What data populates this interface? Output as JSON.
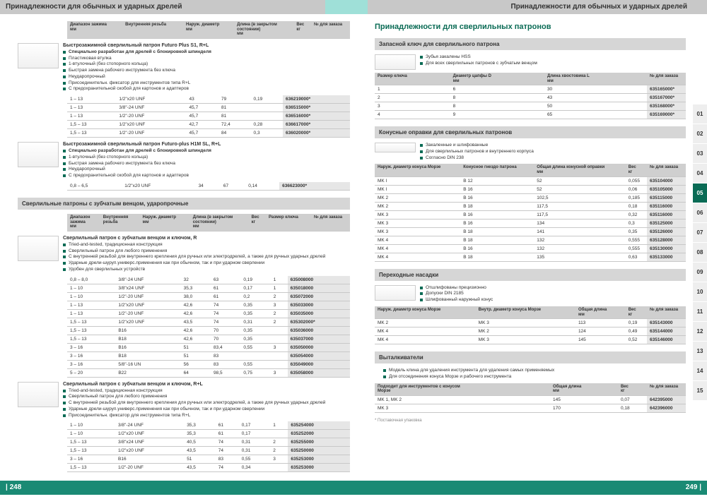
{
  "header_left": "Принадлежности для обычных и ударных дрелей",
  "header_right": "Принадлежности для обычных и ударных дрелей",
  "page_left": "| 248",
  "page_right": "249 |",
  "tabs": [
    "01",
    "02",
    "03",
    "04",
    "05",
    "06",
    "07",
    "08",
    "09",
    "10",
    "11",
    "12",
    "13",
    "14",
    "15"
  ],
  "tab_active": "05",
  "footnote": "* Поставочная упаковка",
  "left": {
    "hdr1": [
      "Диапазон зажима\nмм",
      "Внутренняя резьба",
      "Наруж. диаметр\nмм",
      "Длина (в закрытом\nсостоянии)\nмм",
      "Вес\nкг",
      "№ для заказа"
    ],
    "p1": {
      "title": "Быстрозажимной сверлильный патрон Futuro Plus S1, R+L",
      "features": [
        "Специально разработан для дрелей с блокировкой шпинделя",
        "Пластиковая втулка",
        "1-втулочный (без стопорного кольца)",
        "Быстрая замена рабочего инструмента без ключа",
        "Неударопрочный",
        "Присоединительн. фиксатор для инструментов типа R+L",
        "С предохранительной скобой для картонов и адаптеров"
      ],
      "rows": [
        [
          "1 – 13",
          "1/2\"x20 UNF",
          "43",
          "79",
          "0,19",
          "636219000*"
        ],
        [
          "1 – 13",
          "3/8\"-24 UNF",
          "45,7",
          "81",
          "",
          "636515000*"
        ],
        [
          "1 – 13",
          "1/2\"-20 UNF",
          "45,7",
          "81",
          "",
          "636516000*"
        ],
        [
          "1,5 – 13",
          "1/2\"x20 UNF",
          "42,7",
          "72,4",
          "0,28",
          "636617000*"
        ],
        [
          "1,5 – 13",
          "1/2\"-20 UNF",
          "45,7",
          "84",
          "0,3",
          "636020000*"
        ]
      ]
    },
    "p2": {
      "title": "Быстрозажимной сверлильный патрон Futuro-plus H1M SL, R+L",
      "features": [
        "Специально разработан для дрелей с блокировкой шпинделя",
        "1-втулочный (без стопорного кольца)",
        "Быстрая замена рабочего инструмента без ключа",
        "Неударопрочный",
        "С предохранительной скобой для картонов и адаптеров"
      ],
      "rows": [
        [
          "0,8 – 6,5",
          "1/2\"x20 UNF",
          "34",
          "67",
          "0,14",
          "636623000*"
        ]
      ]
    },
    "section2": "Сверлильные патроны с зубчатым венцом, ударопрочные",
    "hdr2": [
      "Диапазон\nзажима\nмм",
      "Внутренняя\nрезьба",
      "Наруж. диаметр\nмм",
      "Длина (в закрытом\nсостоянии)\nмм",
      "Вес\nкг",
      "Размер ключа",
      "№ для заказа"
    ],
    "p3": {
      "title": "Сверлильный патрон с зубчатым венцом и ключом, R",
      "features": [
        "Tried-and-tested, традиционная конструкция",
        "Сверлильный патрон для любого применения",
        "С внутренней резьбой для внутреннего крепления для ручных или электродрелей, а также для ручных ударных дрелей",
        "Ударные дрели-шуруп.универс.применения как при обычном, так и при ударном сверлении",
        "Удобен для сверлильных устройств"
      ],
      "rows": [
        [
          "0,8 – 8,0",
          "3/8\"-24 UNF",
          "32",
          "63",
          "0,19",
          "1",
          "635008000"
        ],
        [
          "1 – 10",
          "3/8\"x24 UNF",
          "35,3",
          "61",
          "0,17",
          "1",
          "635018000"
        ],
        [
          "1 – 10",
          "1/2\"-20 UNF",
          "38,0",
          "61",
          "0,2",
          "2",
          "635072000"
        ],
        [
          "1 – 13",
          "1/2\"x20 UNF",
          "42,6",
          "74",
          "0,35",
          "3",
          "635033000"
        ],
        [
          "1 – 13",
          "1/2\"-20 UNF",
          "42,6",
          "74",
          "0,35",
          "2",
          "635035000"
        ],
        [
          "1,5 – 13",
          "1/2\"x20 UNF",
          "43,5",
          "74",
          "0,31",
          "2",
          "635302000*"
        ],
        [
          "1,5 – 13",
          "B16",
          "42,6",
          "70",
          "0,35",
          "",
          "635036000"
        ],
        [
          "1,5 – 13",
          "B18",
          "42,6",
          "70",
          "0,35",
          "",
          "635037000"
        ],
        [
          "3 – 16",
          "B16",
          "51",
          "83,4",
          "0,55",
          "3",
          "635050000"
        ],
        [
          "3 – 16",
          "B18",
          "51",
          "83",
          "",
          "",
          "635054000"
        ],
        [
          "3 – 16",
          "5/8\"-16 UN",
          "56",
          "83",
          "0,55",
          "",
          "635049000"
        ],
        [
          "5 – 20",
          "B22",
          "64",
          "98,5",
          "0,75",
          "3",
          "635058000"
        ]
      ]
    },
    "p4": {
      "title": "Сверлильный патрон с зубчатым венцом и ключом, R+L",
      "features": [
        "Tried-and-tested, традиционная конструкция",
        "Сверлильный патрон для любого применения",
        "С внутренней резьбой для внутреннего крепления для ручных или электродрелей, а также для ручных ударных дрелей",
        "Ударные дрели-шуруп.универс.применения как при обычном, так и при ударном сверлении",
        "Присоединительн. фиксатор для инструментов типа R+L"
      ],
      "rows": [
        [
          "1 – 10",
          "3/8\"-24 UNF",
          "35,3",
          "61",
          "0,17",
          "1",
          "635254000"
        ],
        [
          "1 – 10",
          "1/2\"x20 UNF",
          "35,3",
          "61",
          "0,17",
          "",
          "635252000"
        ],
        [
          "1,5 – 13",
          "3/8\"x24 UNF",
          "40,5",
          "74",
          "0,31",
          "2",
          "635255000"
        ],
        [
          "1,5 – 13",
          "1/2\"x20 UNF",
          "43,5",
          "74",
          "0,31",
          "2",
          "635250000"
        ],
        [
          "3 – 16",
          "B16",
          "51",
          "83",
          "0,55",
          "3",
          "635253000"
        ],
        [
          "1,5 – 13",
          "1/2\"-20 UNF",
          "43,5",
          "74",
          "0,34",
          "",
          "635253000"
        ]
      ]
    }
  },
  "right": {
    "title": "Принадлежности для сверлильных патронов",
    "s1": {
      "bar": "Запасной ключ для сверлильного патрона",
      "features": [
        "Зубья закалены HSS",
        "Для всех сверлильных патронов с зубчатым венцом"
      ],
      "hdr": [
        "Размер ключа",
        "Диаметр цапфы D\nмм",
        "Длина хвостовика L\nмм",
        "№ для заказа"
      ],
      "rows": [
        [
          "1",
          "6",
          "30",
          "635165000*"
        ],
        [
          "2",
          "8",
          "43",
          "635167000*"
        ],
        [
          "3",
          "8",
          "50",
          "635168000*"
        ],
        [
          "4",
          "9",
          "65",
          "635169000*"
        ]
      ]
    },
    "s2": {
      "bar": "Конусные оправки для сверлильных патронов",
      "features": [
        "Закаленные и шлифованные",
        "Для сверлильных патронов и внутреннего корпуса",
        "Согласно DIN 238"
      ],
      "hdr": [
        "Наруж. диаметр конуса Морзе",
        "Конусное гнездо патрона",
        "Общая длина конусной оправки\nмм",
        "Вес\nкг",
        "№ для заказа"
      ],
      "rows": [
        [
          "MK I",
          "B 12",
          "52",
          "0,055",
          "635104000"
        ],
        [
          "MK I",
          "B 16",
          "52",
          "0,06",
          "635105000"
        ],
        [
          "MK 2",
          "B 16",
          "102,5",
          "0,185",
          "635115000"
        ],
        [
          "MK 2",
          "B 18",
          "117,5",
          "0,18",
          "635116000"
        ],
        [
          "MK 3",
          "B 16",
          "117,5",
          "0,32",
          "635116000"
        ],
        [
          "MK 3",
          "B 16",
          "134",
          "0,3",
          "635125000"
        ],
        [
          "MK 3",
          "B 18",
          "141",
          "0,35",
          "635126000"
        ],
        [
          "MK 4",
          "B 18",
          "132",
          "0,555",
          "635128000"
        ],
        [
          "MK 4",
          "B 16",
          "132",
          "0,555",
          "635130000"
        ],
        [
          "MK 4",
          "B 18",
          "135",
          "0,63",
          "635133000"
        ]
      ]
    },
    "s3": {
      "bar": "Переходные насадки",
      "features": [
        "Отшлифованы прецизионно",
        "Допуски DIN 2185",
        "Шлифованный наружный конус"
      ],
      "hdr": [
        "Наруж. диаметр конуса Морзе",
        "Внутр. диаметр конуса Морзе",
        "Общая длина\nмм",
        "Вес\nкг",
        "№ для заказа"
      ],
      "rows": [
        [
          "MK 2",
          "MK 3",
          "113",
          "0,19",
          "635143000"
        ],
        [
          "MK 4",
          "MK 2",
          "124",
          "0,49",
          "635144000"
        ],
        [
          "MK 4",
          "MK 3",
          "145",
          "0,52",
          "635146000"
        ]
      ]
    },
    "s4": {
      "bar": "Выталкиватели",
      "feat": [
        "Модель клина для удаления инструмента для удаления самых применяемых",
        "Для отсоединения конуса Морзе и рабочего инструмента"
      ],
      "hdr": [
        "Подходит для инструментов с конусом\nМорзе",
        "Общая длина\nмм",
        "Вес\nкг",
        "№ для заказа"
      ],
      "rows": [
        [
          "MK 1, MK 2",
          "145",
          "0,07",
          "642395000"
        ],
        [
          "MK 3",
          "170",
          "0,18",
          "642396000"
        ]
      ]
    }
  }
}
